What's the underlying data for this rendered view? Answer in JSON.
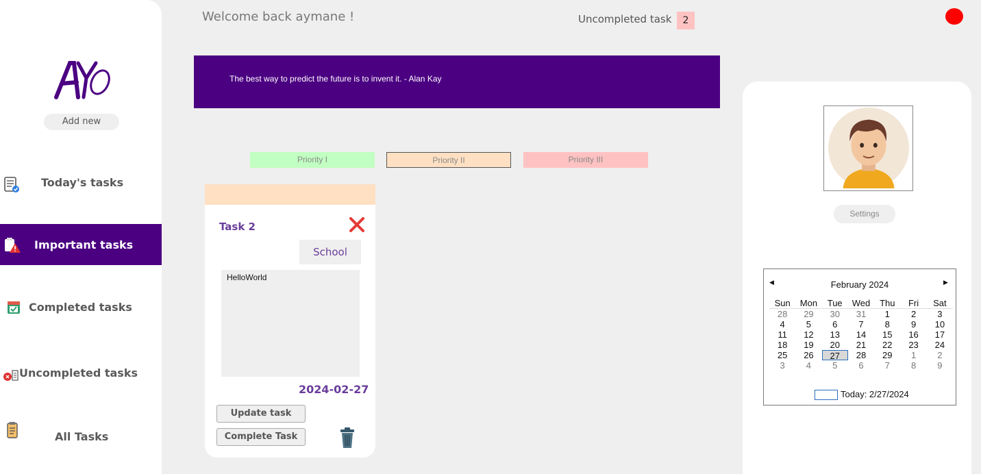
{
  "header": {
    "welcome": "Welcome back aymane !",
    "uncompleted_label": "Uncompleted task",
    "uncompleted_count": "2"
  },
  "sidebar": {
    "logo_text": "AYO",
    "add_new": "Add new",
    "items": [
      {
        "label": "Today's tasks",
        "icon": "checklist-icon"
      },
      {
        "label": "Important tasks",
        "icon": "warning-clipboard-icon",
        "active": true
      },
      {
        "label": "Completed tasks",
        "icon": "calendar-check-icon"
      },
      {
        "label": "Uncompleted tasks",
        "icon": "error-list-icon"
      },
      {
        "label": "All Tasks",
        "icon": "clipboard-icon"
      }
    ]
  },
  "quote": "The best way to predict the future is to invent it. - Alan Kay",
  "priorities": [
    "Priority I",
    "Priority II",
    "Priority III"
  ],
  "task": {
    "title": "Task 2",
    "category": "School",
    "notes": "HelloWorld",
    "date": "2024-02-27",
    "update_label": "Update task",
    "complete_label": "Complete Task"
  },
  "profile": {
    "settings_label": "Settings"
  },
  "calendar": {
    "month": "February 2024",
    "days_of_week": [
      "Sun",
      "Mon",
      "Tue",
      "Wed",
      "Thu",
      "Fri",
      "Sat"
    ],
    "weeks": [
      [
        "28",
        "29",
        "30",
        "31",
        "1",
        "2",
        "3"
      ],
      [
        "4",
        "5",
        "6",
        "7",
        "8",
        "9",
        "10"
      ],
      [
        "11",
        "12",
        "13",
        "14",
        "15",
        "16",
        "17"
      ],
      [
        "18",
        "19",
        "20",
        "21",
        "22",
        "23",
        "24"
      ],
      [
        "25",
        "26",
        "27",
        "28",
        "29",
        "1",
        "2"
      ],
      [
        "3",
        "4",
        "5",
        "6",
        "7",
        "8",
        "9"
      ]
    ],
    "selected": "27",
    "today": "Today: 2/27/2024"
  },
  "colors": {
    "accent": "#4b0082",
    "priority_1": "#c2ffc2",
    "priority_2": "#ffe0c2",
    "priority_3": "#ffc2c2",
    "status_dot": "#ff0000"
  }
}
